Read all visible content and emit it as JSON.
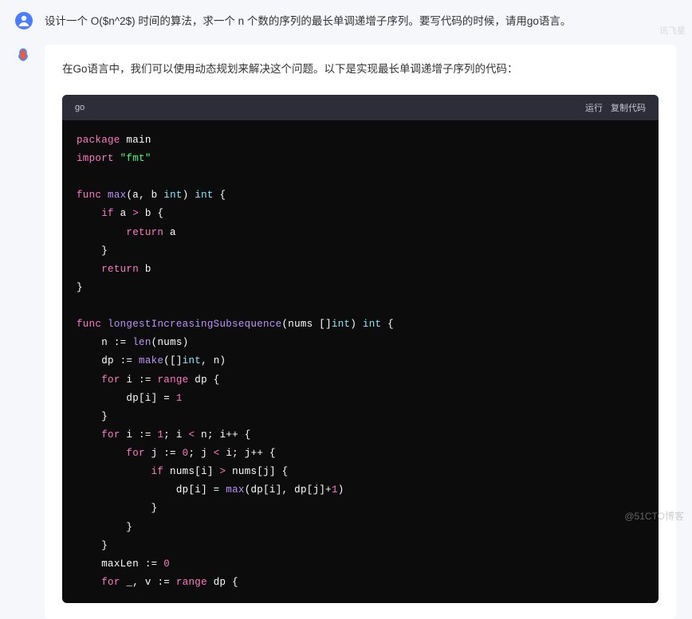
{
  "prompt": "设计一个 O($n^2$) 时间的算法，求一个 n 个数的序列的最长单调递增子序列。要写代码的时候，请用go语言。",
  "answer_intro": "在Go语言中，我们可以使用动态规划来解决这个问题。以下是实现最长单调递增子序列的代码：",
  "code": {
    "lang": "go",
    "run_label": "运行",
    "copy_label": "复制代码"
  },
  "brand_top": "讯飞星",
  "watermark": "@51CTO博客",
  "code_tokens": {
    "package": "package",
    "main": "main",
    "import": "import",
    "fmt": "\"fmt\"",
    "func": "func",
    "max": "max",
    "a": "a",
    "b": "b",
    "int": "int",
    "if": "if",
    "return": "return",
    "lis": "longestIncreasingSubsequence",
    "nums": "nums",
    "n": "n",
    "len": "len",
    "dp": "dp",
    "make": "make",
    "for": "for",
    "i": "i",
    "j": "j",
    "range": "range",
    "one": "1",
    "zero": "0",
    "maxLen": "maxLen",
    "v": "v",
    "underscore": "_"
  }
}
